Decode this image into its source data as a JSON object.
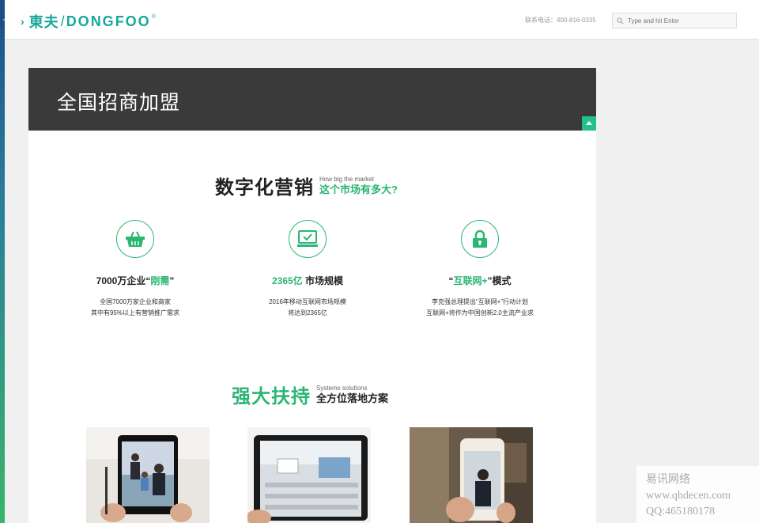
{
  "header": {
    "plus": "+",
    "logo_arrow": "›",
    "logo_cn": "東夫",
    "logo_slash": "/",
    "logo_en": "DONGFOO",
    "logo_reg": "®",
    "phone": "联系电话：400-816-0335",
    "search_placeholder": "Type and hit Enter"
  },
  "banner": {
    "title": "全国招商加盟"
  },
  "section1": {
    "title": "数字化营销",
    "sub_en": "How big the market",
    "sub_cn": "这个市场有多大?"
  },
  "features": [
    {
      "icon": "basket-icon",
      "title_a": "7000万企业“",
      "title_hl": "刚需",
      "title_b": "”",
      "desc1": "全国7000万家企业和商家",
      "desc2": "其中有95%以上有营销推广需求"
    },
    {
      "icon": "monitor-check-icon",
      "title_hl": "2365亿",
      "title_b": " 市场规模",
      "desc1": "2016年移动互联网市场规模",
      "desc2": "将达到2365亿"
    },
    {
      "icon": "lock-icon",
      "title_a": "“",
      "title_hl": "互联网+",
      "title_b": "”模式",
      "desc1": "李克强总理提出“互联网+”行动计划",
      "desc2": "互联网+将作为中国创新2.0主流产业求"
    }
  ],
  "section2": {
    "title": "强大扶持",
    "sub_en": "Systems solutions",
    "sub_cn": "全方位落地方案"
  },
  "watermark": {
    "line1": "易讯网络",
    "line2": "www.qhdecen.com",
    "line3": "QQ:465180178"
  },
  "colors": {
    "accent": "#2bb673",
    "logo": "#16a89a",
    "banner": "#3a3a3a"
  }
}
